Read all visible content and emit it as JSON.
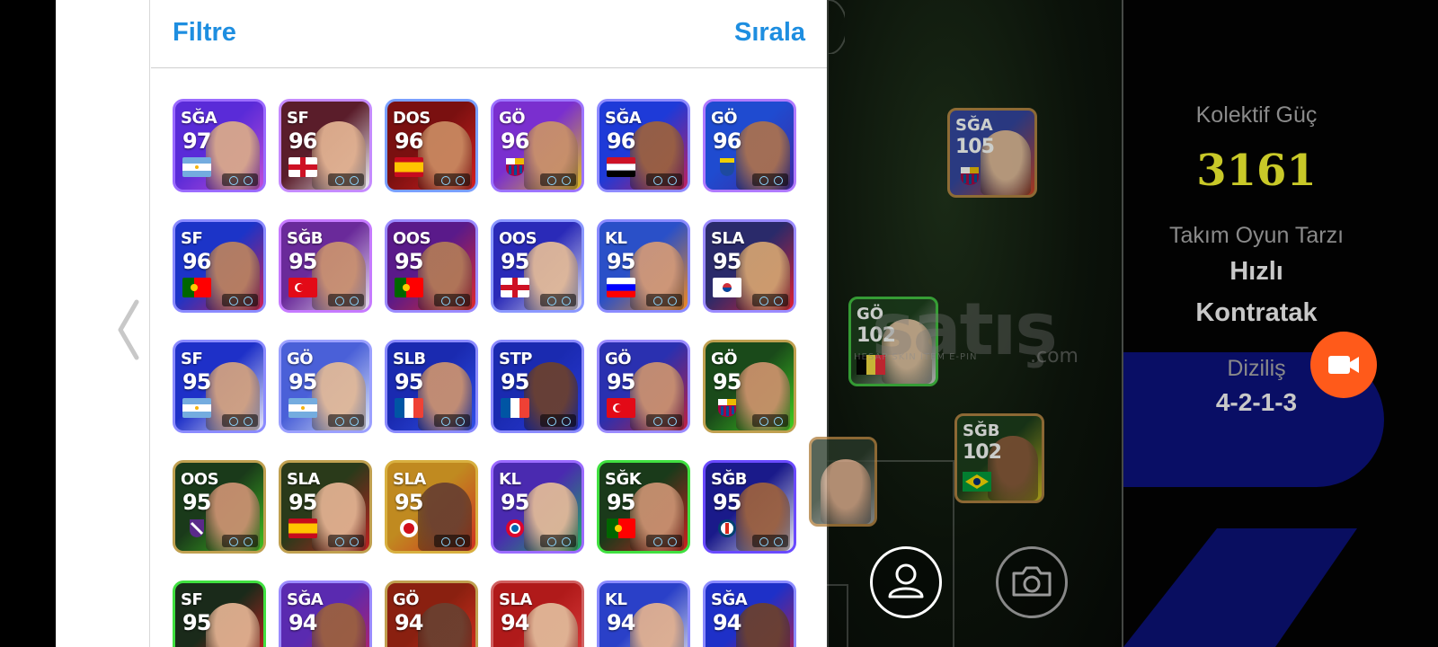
{
  "panel": {
    "filter_label": "Filtre",
    "sort_label": "Sırala"
  },
  "cards": [
    {
      "pos": "SĞA",
      "rating": "97",
      "flag": "argentina",
      "border": "#9b6bff",
      "bg": [
        "#5a2bd8",
        "#c24fd6"
      ],
      "face": "#d8a88a"
    },
    {
      "pos": "SF",
      "rating": "96",
      "flag": "england",
      "border": "#c58bff",
      "bg": [
        "#5a1d2a",
        "#f0f0f8"
      ],
      "face": "#e0b090"
    },
    {
      "pos": "DOS",
      "rating": "96",
      "flag": "spain",
      "border": "#7aa0ff",
      "bg": [
        "#7a1010",
        "#d42020"
      ],
      "face": "#c88860"
    },
    {
      "pos": "GÖ",
      "rating": "96",
      "flag": "barcelona",
      "border": "#9d74ff",
      "bg": [
        "#7a2fcf",
        "#e0c020"
      ],
      "face": "#c8906a"
    },
    {
      "pos": "SĞA",
      "rating": "96",
      "flag": "egypt",
      "border": "#8f8bff",
      "bg": [
        "#1e3ad8",
        "#c02060"
      ],
      "face": "#9a6040"
    },
    {
      "pos": "GÖ",
      "rating": "96",
      "flag": "club-crest",
      "border": "#b07aff",
      "bg": [
        "#1f4bd0",
        "#3e2aa0"
      ],
      "face": "#a87050"
    },
    {
      "pos": "SF",
      "rating": "96",
      "flag": "portugal",
      "border": "#8b8bff",
      "bg": [
        "#1c34c8",
        "#d02050"
      ],
      "face": "#b88060"
    },
    {
      "pos": "SĞB",
      "rating": "95",
      "flag": "turkey",
      "border": "#c67aff",
      "bg": [
        "#6a2a9a",
        "#e8e0f0"
      ],
      "face": "#c89070"
    },
    {
      "pos": "OOS",
      "rating": "95",
      "flag": "portugal",
      "border": "#9b8bff",
      "bg": [
        "#5a1a8a",
        "#e02a2a"
      ],
      "face": "#b07858"
    },
    {
      "pos": "OOS",
      "rating": "95",
      "flag": "england",
      "border": "#8b98ff",
      "bg": [
        "#2a2ab8",
        "#e0e0f0"
      ],
      "face": "#e0b898"
    },
    {
      "pos": "KL",
      "rating": "95",
      "flag": "slovenia",
      "border": "#8b8bff",
      "bg": [
        "#2a50c8",
        "#f08a20"
      ],
      "face": "#d09878"
    },
    {
      "pos": "SLA",
      "rating": "95",
      "flag": "korea",
      "border": "#9b8bff",
      "bg": [
        "#2a2a6a",
        "#e02030"
      ],
      "face": "#d0a070"
    },
    {
      "pos": "SF",
      "rating": "95",
      "flag": "argentina",
      "border": "#8b8bff",
      "bg": [
        "#1e30c8",
        "#e8e8f8"
      ],
      "face": "#d0a080"
    },
    {
      "pos": "GÖ",
      "rating": "95",
      "flag": "argentina",
      "border": "#9ba0ff",
      "bg": [
        "#4a60d8",
        "#e0e8f8"
      ],
      "face": "#e0b898"
    },
    {
      "pos": "SLB",
      "rating": "95",
      "flag": "france",
      "border": "#8b8bff",
      "bg": [
        "#1a2ab0",
        "#3050e8"
      ],
      "face": "#c89070"
    },
    {
      "pos": "STP",
      "rating": "95",
      "flag": "france",
      "border": "#8b8bff",
      "bg": [
        "#1a2ab0",
        "#2a3ad8"
      ],
      "face": "#6a4030"
    },
    {
      "pos": "GÖ",
      "rating": "95",
      "flag": "turkey",
      "border": "#9b8bff",
      "bg": [
        "#2a30b0",
        "#c02040"
      ],
      "face": "#c89070"
    },
    {
      "pos": "GÖ",
      "rating": "95",
      "flag": "barcelona",
      "border": "#c0a050",
      "bg": [
        "#1a4a1a",
        "#40d020"
      ],
      "face": "#c8906a"
    },
    {
      "pos": "OOS",
      "rating": "95",
      "flag": "club-crest-2",
      "border": "#c0a050",
      "bg": [
        "#1a3a1a",
        "#40c020"
      ],
      "face": "#c89070"
    },
    {
      "pos": "SLA",
      "rating": "95",
      "flag": "spain",
      "border": "#c0a050",
      "bg": [
        "#2a3a1a",
        "#c02020"
      ],
      "face": "#e0b090"
    },
    {
      "pos": "SLA",
      "rating": "95",
      "flag": "club-crest-3",
      "border": "#d8b040",
      "bg": [
        "#c08a20",
        "#d03020"
      ],
      "face": "#6a4030"
    },
    {
      "pos": "KL",
      "rating": "95",
      "flag": "bayern",
      "border": "#9b6bff",
      "bg": [
        "#4a2ab0",
        "#20b060"
      ],
      "face": "#e0b898"
    },
    {
      "pos": "SĞK",
      "rating": "95",
      "flag": "portugal",
      "border": "#40e040",
      "bg": [
        "#1a3a1a",
        "#d02020"
      ],
      "face": "#c89070"
    },
    {
      "pos": "SĞB",
      "rating": "95",
      "flag": "psg",
      "border": "#6a4aff",
      "bg": [
        "#1a1a8a",
        "#e8e8f0"
      ],
      "face": "#9a6040"
    },
    {
      "pos": "SF",
      "rating": "95",
      "flag": "none",
      "border": "#40e040",
      "bg": [
        "#1a2a1a",
        "#e02020"
      ],
      "face": "#e0b090"
    },
    {
      "pos": "SĞA",
      "rating": "94",
      "flag": "none",
      "border": "#9b8bff",
      "bg": [
        "#5a2ab0",
        "#c02060"
      ],
      "face": "#9a6040"
    },
    {
      "pos": "GÖ",
      "rating": "94",
      "flag": "none",
      "border": "#c0a050",
      "bg": [
        "#8a2010",
        "#e03020"
      ],
      "face": "#6a4030"
    },
    {
      "pos": "SLA",
      "rating": "94",
      "flag": "none",
      "border": "#d06060",
      "bg": [
        "#b01a1a",
        "#e04040"
      ],
      "face": "#e0b898"
    },
    {
      "pos": "KL",
      "rating": "94",
      "flag": "none",
      "border": "#8b8bff",
      "bg": [
        "#2a40c8",
        "#e0e0e8"
      ],
      "face": "#e0b090"
    },
    {
      "pos": "SĞA",
      "rating": "94",
      "flag": "none",
      "border": "#8b8bff",
      "bg": [
        "#1e30c8",
        "#c02040"
      ],
      "face": "#6a4030"
    }
  ],
  "pitch_cards": [
    {
      "pos": "SĞA",
      "rating": "105",
      "flag": "barcelona",
      "border": "#b08040",
      "bg": [
        "#3040a0",
        "#d04020"
      ],
      "face": "#e0b898"
    },
    {
      "pos": "GÖ",
      "rating": "102",
      "flag": "belgium",
      "border": "#40c040",
      "bg": [
        "#1a3a1a",
        "#d0d0d0"
      ],
      "face": "#e0c0a0"
    },
    {
      "pos": "SĞB",
      "rating": "102",
      "flag": "brazil",
      "border": "#b08040",
      "bg": [
        "#1a3a1a",
        "#d0c020"
      ],
      "face": "#8a5a3a"
    },
    {
      "pos": "",
      "rating": "",
      "flag": "none",
      "border": "#b08040",
      "bg": [
        "#2a3a2a",
        "#a0a0a0"
      ],
      "face": "#e0b090"
    }
  ],
  "watermark": {
    "text": "satış",
    "sub": "HESAP  SKIN  ITEM  E-PIN",
    "com": ".com"
  },
  "stats": {
    "collective_label": "Kolektif Güç",
    "collective_value": "3161",
    "style_label": "Takım Oyun Tarzı",
    "style_value_1": "Hızlı",
    "style_value_2": "Kontratak",
    "formation_label": "Diziliş",
    "formation_value": "4-2-1-3"
  },
  "colors": {
    "accent_blue": "#1e8ee0",
    "record_orange": "#ff5a1a",
    "power_yellow": "#c8c828"
  }
}
